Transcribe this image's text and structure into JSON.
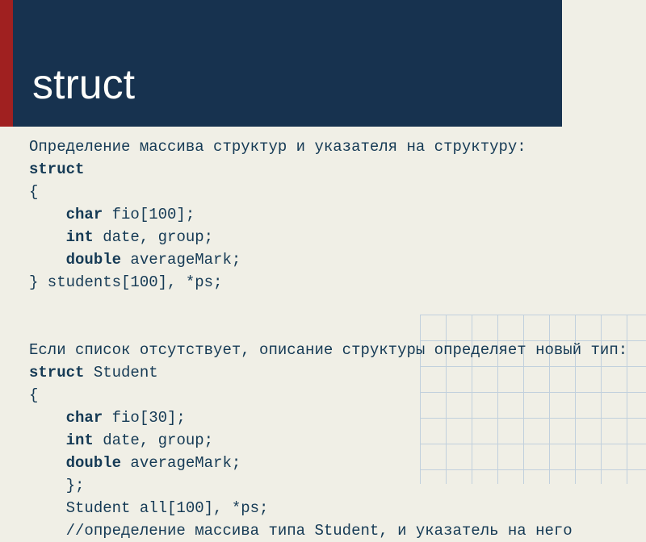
{
  "header": {
    "title": "struct"
  },
  "block1": {
    "intro": "Определение массива структур и указателя на структуру:",
    "l1": "struct",
    "l2": "{",
    "l3a": "char",
    "l3b": " fio[100];",
    "l4a": "int",
    "l4b": " date, group;",
    "l5a": "double",
    "l5b": " averageMark;",
    "l6": "} students[100], *ps;"
  },
  "block2": {
    "intro": "Если список отсутствует, описание структуры определяет новый тип:",
    "l1a": "struct",
    "l1b": " Student",
    "l2": "{",
    "l3a": "char",
    "l3b": " fio[30];",
    "l4a": "int",
    "l4b": " date, group;",
    "l5a": "double",
    "l5b": " averageMark;",
    "l6": "};",
    "l7": "Student all[100], *ps;",
    "l8": "//определение массива типа Student, и указатель на него"
  }
}
